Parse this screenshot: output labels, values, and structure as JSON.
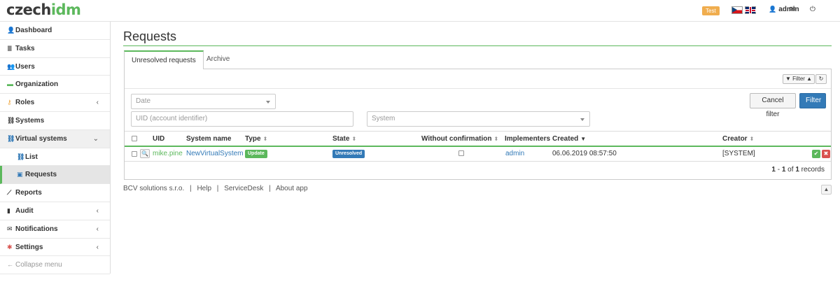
{
  "header": {
    "logo_part1": "czech",
    "logo_part2": "idm",
    "env_badge": "Test",
    "username": "admin"
  },
  "sidebar": {
    "items": [
      {
        "label": "Dashboard",
        "icon": "user-icon",
        "glyph": "👤"
      },
      {
        "label": "Tasks",
        "icon": "list-icon",
        "glyph": "≣"
      },
      {
        "label": "Users",
        "icon": "users-icon",
        "glyph": "👥"
      },
      {
        "label": "Organization",
        "icon": "folder-icon",
        "glyph": "▬"
      },
      {
        "label": "Roles",
        "icon": "key-icon",
        "glyph": "⚷"
      },
      {
        "label": "Systems",
        "icon": "link-icon",
        "glyph": "⛓"
      },
      {
        "label": "Virtual systems",
        "icon": "link-icon",
        "glyph": "⛓"
      },
      {
        "label": "List",
        "icon": "link-icon",
        "glyph": "⛓"
      },
      {
        "label": "Requests",
        "icon": "inbox-icon",
        "glyph": "▣"
      },
      {
        "label": "Reports",
        "icon": "line-chart-icon",
        "glyph": "⟋"
      },
      {
        "label": "Audit",
        "icon": "bar-chart-icon",
        "glyph": "▮"
      },
      {
        "label": "Notifications",
        "icon": "envelope-icon",
        "glyph": "✉"
      },
      {
        "label": "Settings",
        "icon": "cog-icon",
        "glyph": "✱"
      },
      {
        "label": "Collapse menu",
        "icon": "arrow-left-icon",
        "glyph": "←"
      }
    ]
  },
  "page": {
    "title": "Requests",
    "tabs": [
      "Unresolved requests",
      "Archive"
    ]
  },
  "toolbar": {
    "filter_label": "Filter"
  },
  "filters": {
    "date_placeholder": "Date",
    "uid_placeholder": "UID (account identifier)",
    "system_placeholder": "System",
    "cancel_label": "Cancel filter",
    "apply_label": "Filter"
  },
  "table": {
    "columns": [
      "UID",
      "System name",
      "Type",
      "State",
      "Without confirmation",
      "Implementers",
      "Created",
      "Creator"
    ],
    "rows": [
      {
        "uid": "mike.pine",
        "system_name": "NewVirtualSystem",
        "type": "Update",
        "state": "Unresolved",
        "implementers": "admin",
        "created": "06.06.2019 08:57:50",
        "creator": "[SYSTEM]"
      }
    ],
    "records": {
      "from": "1",
      "dash": " - ",
      "to": "1",
      "of": " of ",
      "total": "1",
      "suffix": " records"
    }
  },
  "footer": {
    "company": "BCV solutions s.r.o.",
    "links": [
      "Help",
      "ServiceDesk",
      "About app"
    ],
    "separator": "|"
  },
  "colors": {
    "accent_green": "#5cb85c",
    "primary_blue": "#337ab7",
    "danger_red": "#d9534f",
    "warning_orange": "#f0ad4e"
  }
}
